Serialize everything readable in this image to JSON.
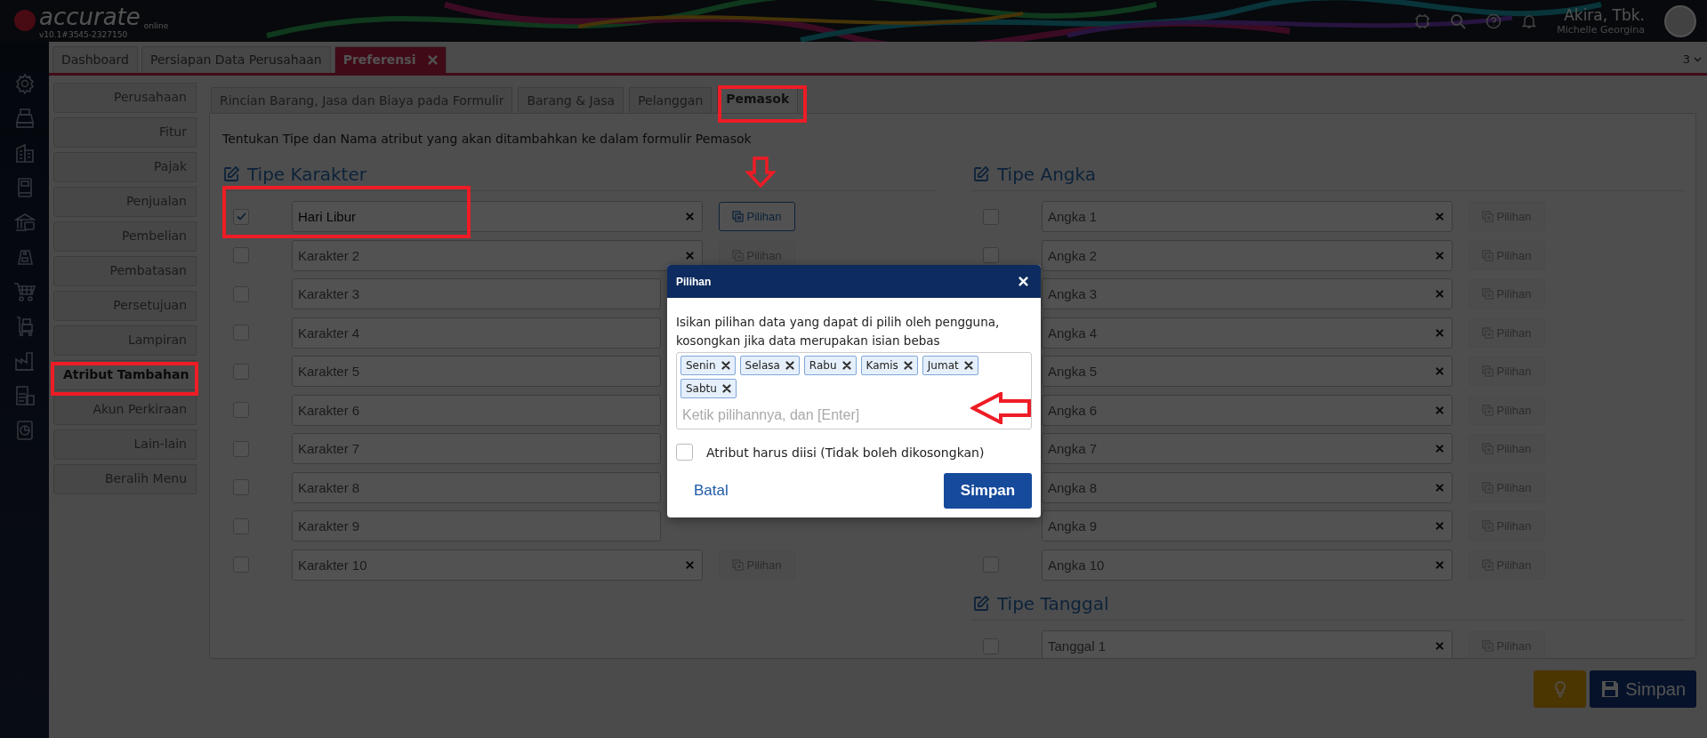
{
  "header": {
    "logo": "accurate",
    "logo_sub": "online",
    "version": "v10.1#3545-2327150",
    "company": "Akira, Tbk.",
    "user": "Michelle Georgina"
  },
  "tabs": [
    {
      "label": "Dashboard",
      "selected": false,
      "closable": false
    },
    {
      "label": "Persiapan Data Perusahaan",
      "selected": false,
      "closable": false
    },
    {
      "label": "Preferensi",
      "selected": true,
      "closable": true
    }
  ],
  "tab_count": "3",
  "menu": [
    {
      "label": "Perusahaan",
      "selected": false
    },
    {
      "label": "Fitur",
      "selected": false
    },
    {
      "label": "Pajak",
      "selected": false
    },
    {
      "label": "Penjualan",
      "selected": false
    },
    {
      "label": "Pembelian",
      "selected": false
    },
    {
      "label": "Pembatasan",
      "selected": false
    },
    {
      "label": "Persetujuan",
      "selected": false
    },
    {
      "label": "Lampiran",
      "selected": false
    },
    {
      "label": "Atribut Tambahan",
      "selected": true
    },
    {
      "label": "Akun Perkiraan",
      "selected": false
    },
    {
      "label": "Lain-lain",
      "selected": false
    },
    {
      "label": "Beralih Menu",
      "selected": false
    }
  ],
  "sub_tabs": [
    {
      "label": "Rincian Barang, Jasa dan Biaya pada Formulir",
      "selected": false
    },
    {
      "label": "Barang & Jasa",
      "selected": false
    },
    {
      "label": "Pelanggan",
      "selected": false
    },
    {
      "label": "Pemasok",
      "selected": true
    }
  ],
  "description": "Tentukan Tipe dan Nama atribut yang akan ditambahkan ke dalam formulir Pemasok",
  "columns": [
    {
      "sections": [
        {
          "title": "Tipe Karakter",
          "rows": [
            {
              "value": "Hari Libur",
              "checked": true,
              "option": "Pilihan",
              "option_enabled": true
            },
            {
              "placeholder": "Karakter 2",
              "checked": false,
              "option": "Pilihan",
              "option_enabled": false
            },
            {
              "placeholder": "Karakter 3",
              "checked": false
            },
            {
              "placeholder": "Karakter 4",
              "checked": false
            },
            {
              "placeholder": "Karakter 5",
              "checked": false
            },
            {
              "placeholder": "Karakter 6",
              "checked": false
            },
            {
              "placeholder": "Karakter 7",
              "checked": false
            },
            {
              "placeholder": "Karakter 8",
              "checked": false
            },
            {
              "placeholder": "Karakter 9",
              "checked": false
            },
            {
              "placeholder": "Karakter 10",
              "checked": false,
              "option": "Pilihan",
              "option_enabled": false
            }
          ]
        }
      ]
    },
    {
      "sections": [
        {
          "title": "Tipe Angka",
          "rows": [
            {
              "placeholder": "Angka 1",
              "checked": false,
              "option": "Pilihan",
              "option_enabled": false
            },
            {
              "placeholder": "Angka 2",
              "checked": false,
              "option": "Pilihan",
              "option_enabled": false
            },
            {
              "placeholder": "Angka 3",
              "option": "Pilihan",
              "option_enabled": false
            },
            {
              "placeholder": "Angka 4",
              "option": "Pilihan",
              "option_enabled": false
            },
            {
              "placeholder": "Angka 5",
              "option": "Pilihan",
              "option_enabled": false
            },
            {
              "placeholder": "Angka 6",
              "option": "Pilihan",
              "option_enabled": false
            },
            {
              "placeholder": "Angka 7",
              "option": "Pilihan",
              "option_enabled": false
            },
            {
              "placeholder": "Angka 8",
              "option": "Pilihan",
              "option_enabled": false
            },
            {
              "placeholder": "Angka 9",
              "option": "Pilihan",
              "option_enabled": false
            },
            {
              "placeholder": "Angka 10",
              "checked": false,
              "option": "Pilihan",
              "option_enabled": false
            }
          ]
        },
        {
          "title": "Tipe Tanggal",
          "rows": [
            {
              "placeholder": "Tanggal 1",
              "checked": false,
              "option": "Pilihan",
              "option_enabled": false
            }
          ]
        }
      ]
    }
  ],
  "footer": {
    "save": "Simpan"
  },
  "dialog": {
    "title": "Pilihan",
    "instruction": "Isikan pilihan data yang dapat di pilih oleh pengguna, kosongkan jika data merupakan isian bebas",
    "tags": [
      "Senin",
      "Selasa",
      "Rabu",
      "Kamis",
      "Jumat",
      "Sabtu"
    ],
    "placeholder": "Ketik pilihannya, dan [Enter]",
    "required_label": "Atribut harus diisi (Tidak boleh dikosongkan)",
    "required_checked": false,
    "cancel": "Batal",
    "save": "Simpan"
  }
}
